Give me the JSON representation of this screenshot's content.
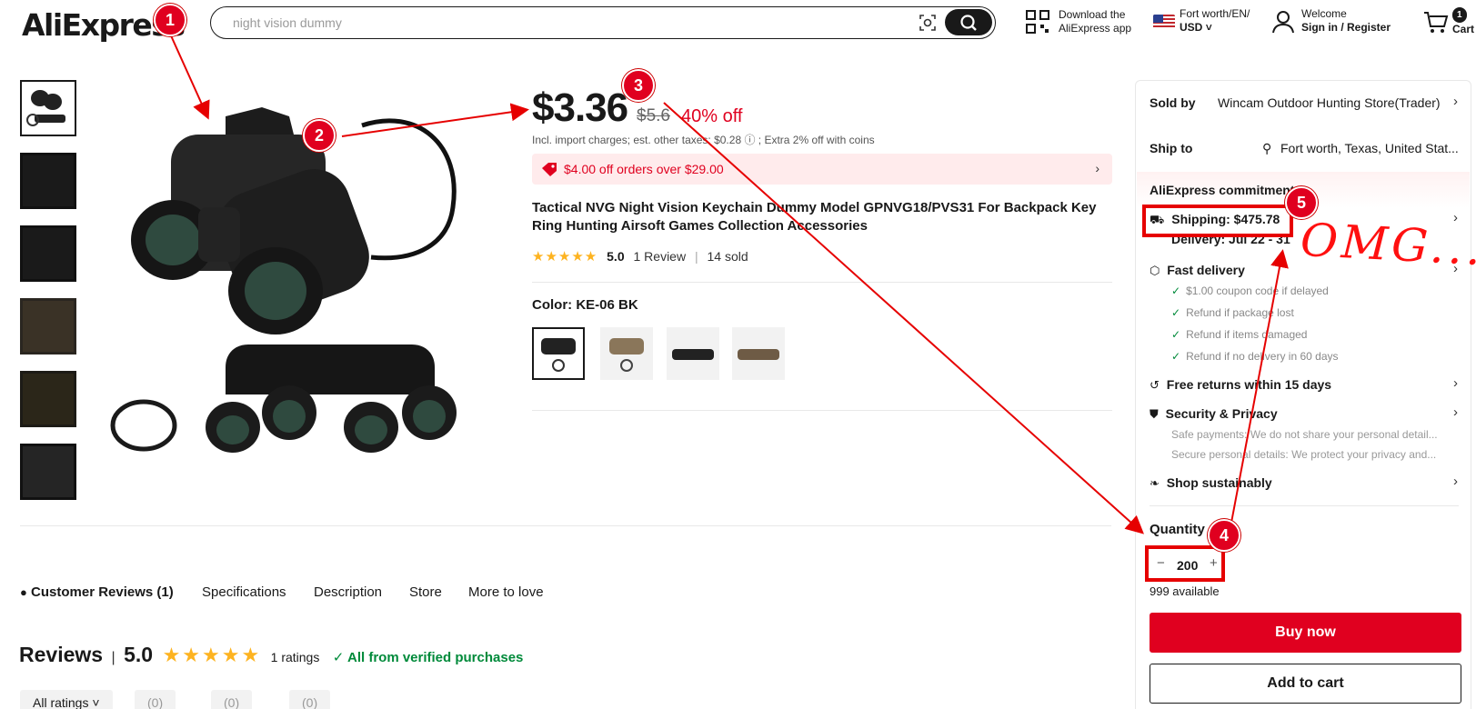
{
  "header": {
    "logo": "AliExpress",
    "search_placeholder": "night vision dummy",
    "app_line1": "Download the",
    "app_line2": "AliExpress app",
    "region_line1": "Fort worth/EN/",
    "region_line2": "USD",
    "account_line1": "Welcome",
    "account_line2": "Sign in / Register",
    "cart_count": "1",
    "cart_label": "Cart"
  },
  "product": {
    "price": "$3.36",
    "old_price": "$5.6",
    "discount": "40% off",
    "tax_note": "Incl. import charges; est. other taxes: $0.28 ⓘ ; Extra 2% off with coins",
    "promo": "$4.00 off orders over $29.00",
    "title": "Tactical NVG Night Vision Keychain Dummy Model GPNVG18/PVS31 For Backpack Key Ring Hunting Airsoft Games Collection Accessories",
    "stars": "★★★★★",
    "rating": "5.0",
    "reviews": "1 Review",
    "sold": "14 sold",
    "color_label": "Color: KE-06 BK"
  },
  "tabs": [
    "Customer Reviews (1)",
    "Specifications",
    "Description",
    "Store",
    "More to love"
  ],
  "reviews": {
    "heading": "Reviews",
    "score": "5.0",
    "stars": "★★★★★",
    "count": "1 ratings",
    "verified": "All from verified purchases",
    "filters": [
      "All ratings ˅",
      "(0)",
      "(0)",
      "(0)"
    ]
  },
  "panel": {
    "sold_by_label": "Sold by",
    "sold_by": "Wincam Outdoor Hunting Store(Trader)",
    "ship_to_label": "Ship to",
    "ship_to": "Fort worth, Texas, United Stat...",
    "commitment": "AliExpress commitment",
    "shipping": "Shipping: $475.78",
    "delivery": "Delivery: Jul 22 - 31",
    "fast_delivery": "Fast delivery",
    "benefits": [
      "$1.00 coupon code if delayed",
      "Refund if package lost",
      "Refund if items damaged",
      "Refund if no delivery in 60 days"
    ],
    "free_returns": "Free returns within 15 days",
    "security": "Security & Privacy",
    "security_sub1": "Safe payments: We do not share your personal detail...",
    "security_sub2": "Secure personal details: We protect your privacy and...",
    "sustain": "Shop sustainably",
    "quantity_label": "Quantity",
    "quantity": "200",
    "available": "999 available",
    "buy_now": "Buy now",
    "add_to_cart": "Add to cart"
  },
  "annotations": {
    "markers": [
      "1",
      "2",
      "3",
      "4",
      "5"
    ],
    "handwriting": "OMG..."
  }
}
